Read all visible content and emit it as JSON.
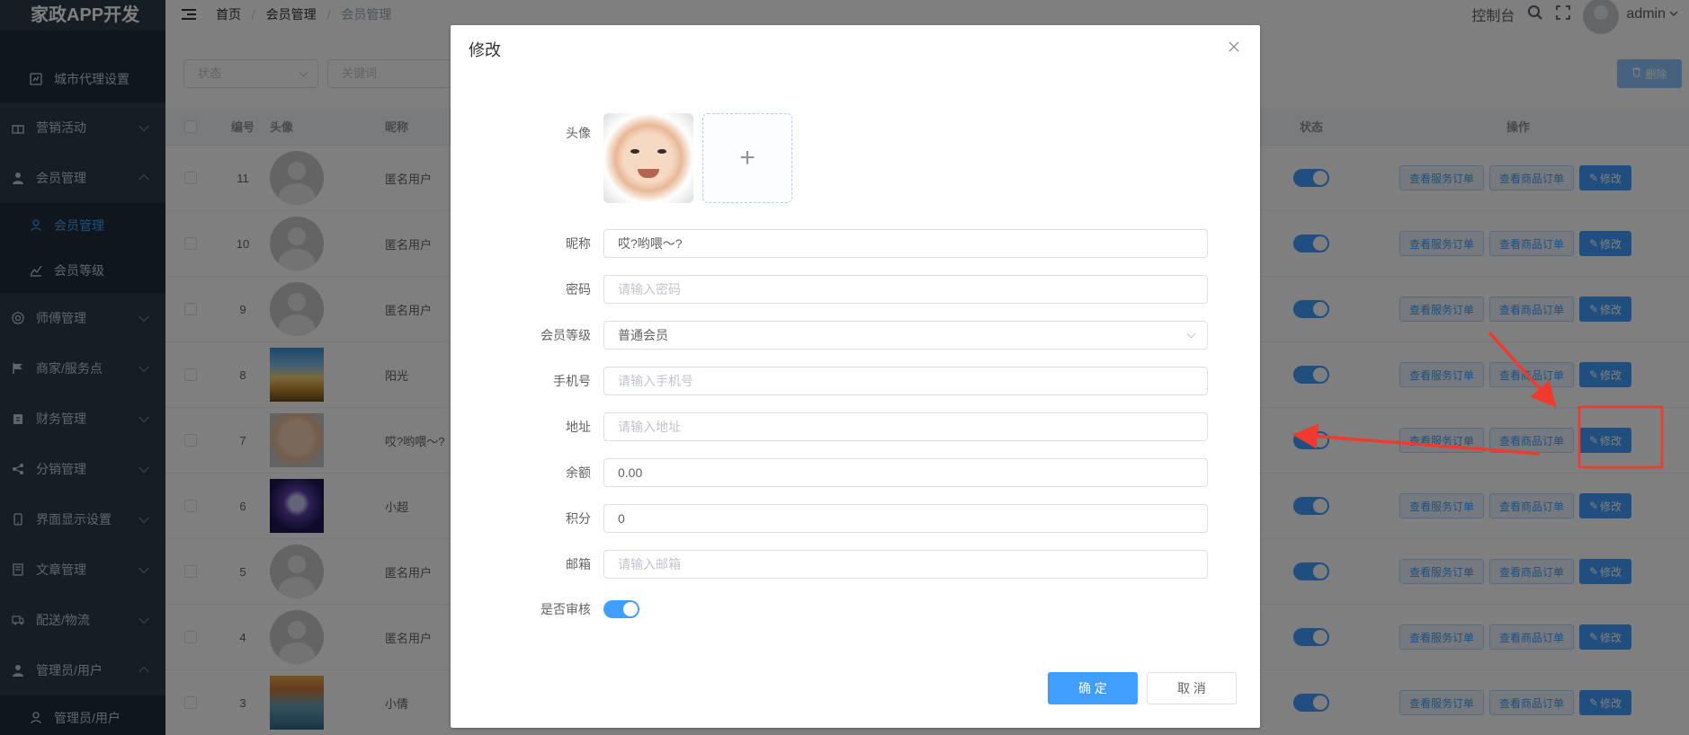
{
  "app": {
    "title": "家政APP开发"
  },
  "sidebar": {
    "items": [
      {
        "label": "城市代理设置",
        "sub": true
      },
      {
        "label": "营销活动",
        "sub": false
      },
      {
        "label": "会员管理",
        "sub": false
      },
      {
        "label": "会员管理",
        "sub": true,
        "active": true
      },
      {
        "label": "会员等级",
        "sub": true
      },
      {
        "label": "师傅管理",
        "sub": false
      },
      {
        "label": "商家/服务点",
        "sub": false
      },
      {
        "label": "财务管理",
        "sub": false
      },
      {
        "label": "分销管理",
        "sub": false
      },
      {
        "label": "界面显示设置",
        "sub": false
      },
      {
        "label": "文章管理",
        "sub": false
      },
      {
        "label": "配送/物流",
        "sub": false
      },
      {
        "label": "管理员/用户",
        "sub": false
      },
      {
        "label": "管理员/用户",
        "sub": true
      }
    ]
  },
  "topbar": {
    "breadcrumb": [
      "首页",
      "会员管理",
      "会员管理"
    ],
    "console": "控制台",
    "user": "admin"
  },
  "filters": {
    "status_placeholder": "状态",
    "keyword_placeholder": "关键词",
    "delete_label": "删除"
  },
  "table": {
    "headers": {
      "id": "编号",
      "avatar": "头像",
      "nickname": "昵称",
      "status": "状态",
      "ops": "操作"
    },
    "rows": [
      {
        "id": "11",
        "nickname": "匿名用户",
        "avatar": "anon"
      },
      {
        "id": "10",
        "nickname": "匿名用户",
        "avatar": "anon"
      },
      {
        "id": "9",
        "nickname": "匿名用户",
        "avatar": "anon"
      },
      {
        "id": "8",
        "nickname": "阳光",
        "avatar": "sunset"
      },
      {
        "id": "7",
        "nickname": "哎?哟喂～?",
        "avatar": "baby"
      },
      {
        "id": "6",
        "nickname": "小超",
        "avatar": "purple"
      },
      {
        "id": "5",
        "nickname": "匿名用户",
        "avatar": "anon"
      },
      {
        "id": "4",
        "nickname": "匿名用户",
        "avatar": "anon"
      },
      {
        "id": "3",
        "nickname": "小倩",
        "avatar": "sea"
      }
    ],
    "op_labels": {
      "service_orders": "查看服务订单",
      "product_orders": "查看商品订单",
      "edit": "修改"
    }
  },
  "dialog": {
    "title": "修改",
    "fields": {
      "avatar_label": "头像",
      "nickname_label": "昵称",
      "nickname_value": "哎?哟喂～?",
      "password_label": "密码",
      "password_placeholder": "请输入密码",
      "level_label": "会员等级",
      "level_value": "普通会员",
      "phone_label": "手机号",
      "phone_placeholder": "请输入手机号",
      "address_label": "地址",
      "address_placeholder": "请输入地址",
      "balance_label": "余额",
      "balance_value": "0.00",
      "points_label": "积分",
      "points_value": "0",
      "email_label": "邮箱",
      "email_placeholder": "请输入邮箱",
      "audit_label": "是否审核"
    },
    "confirm_label": "确 定",
    "cancel_label": "取 消"
  },
  "colors": {
    "primary": "#409eff",
    "sidebar": "#2d3a4b",
    "annotation": "#f03a2e"
  }
}
